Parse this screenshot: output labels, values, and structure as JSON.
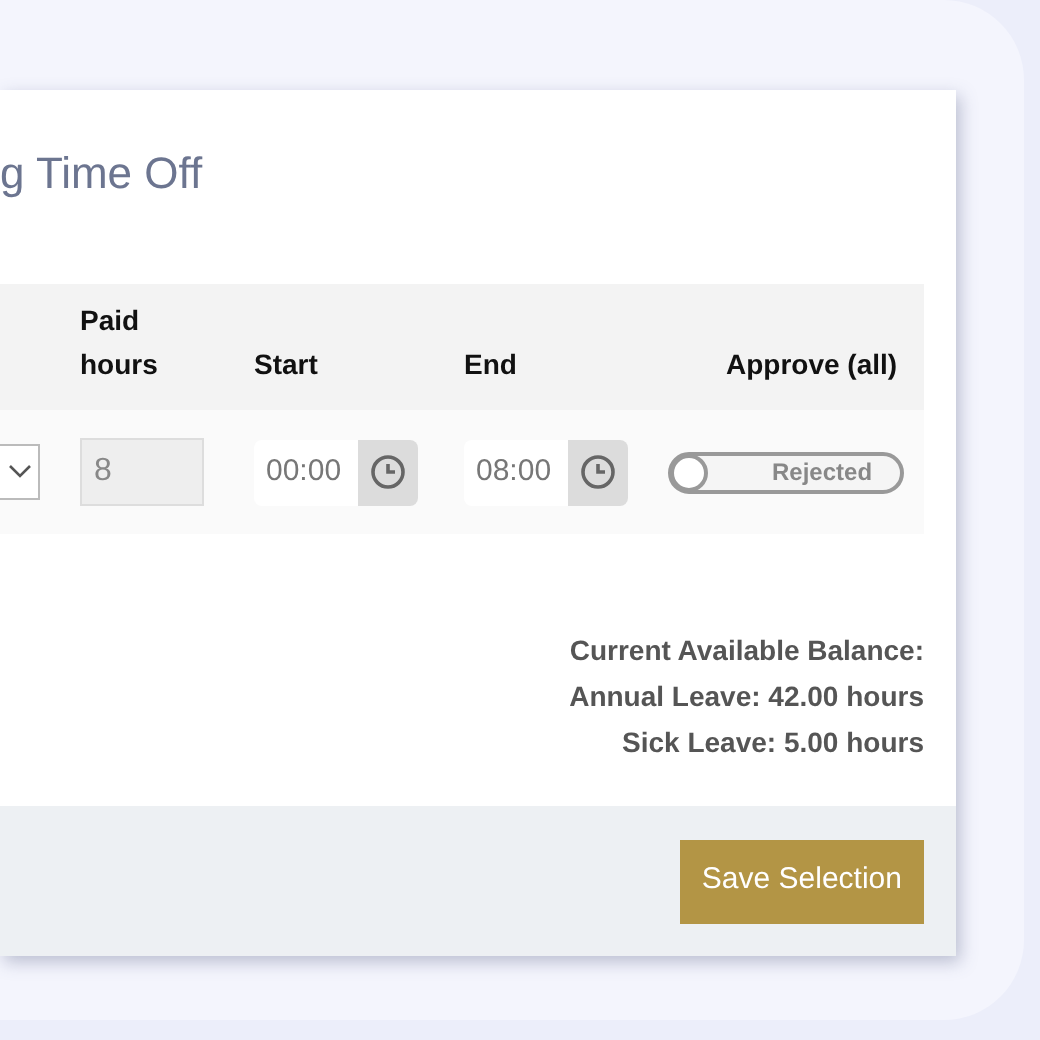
{
  "title": "g Time Off",
  "table": {
    "columns": [
      "Paid\nhours",
      "Start",
      "End",
      "Approve (all)"
    ],
    "rows": [
      {
        "paid_hours": {
          "value": "8",
          "disabled": true
        },
        "start": "00:00",
        "end": "08:00",
        "approve": {
          "on": false,
          "label": "Rejected"
        }
      }
    ]
  },
  "balance": [
    "Current Available Balance:",
    "Annual Leave: 42.00 hours",
    "Sick Leave: 5.00 hours"
  ],
  "footer": {
    "button": "Save Selection"
  }
}
